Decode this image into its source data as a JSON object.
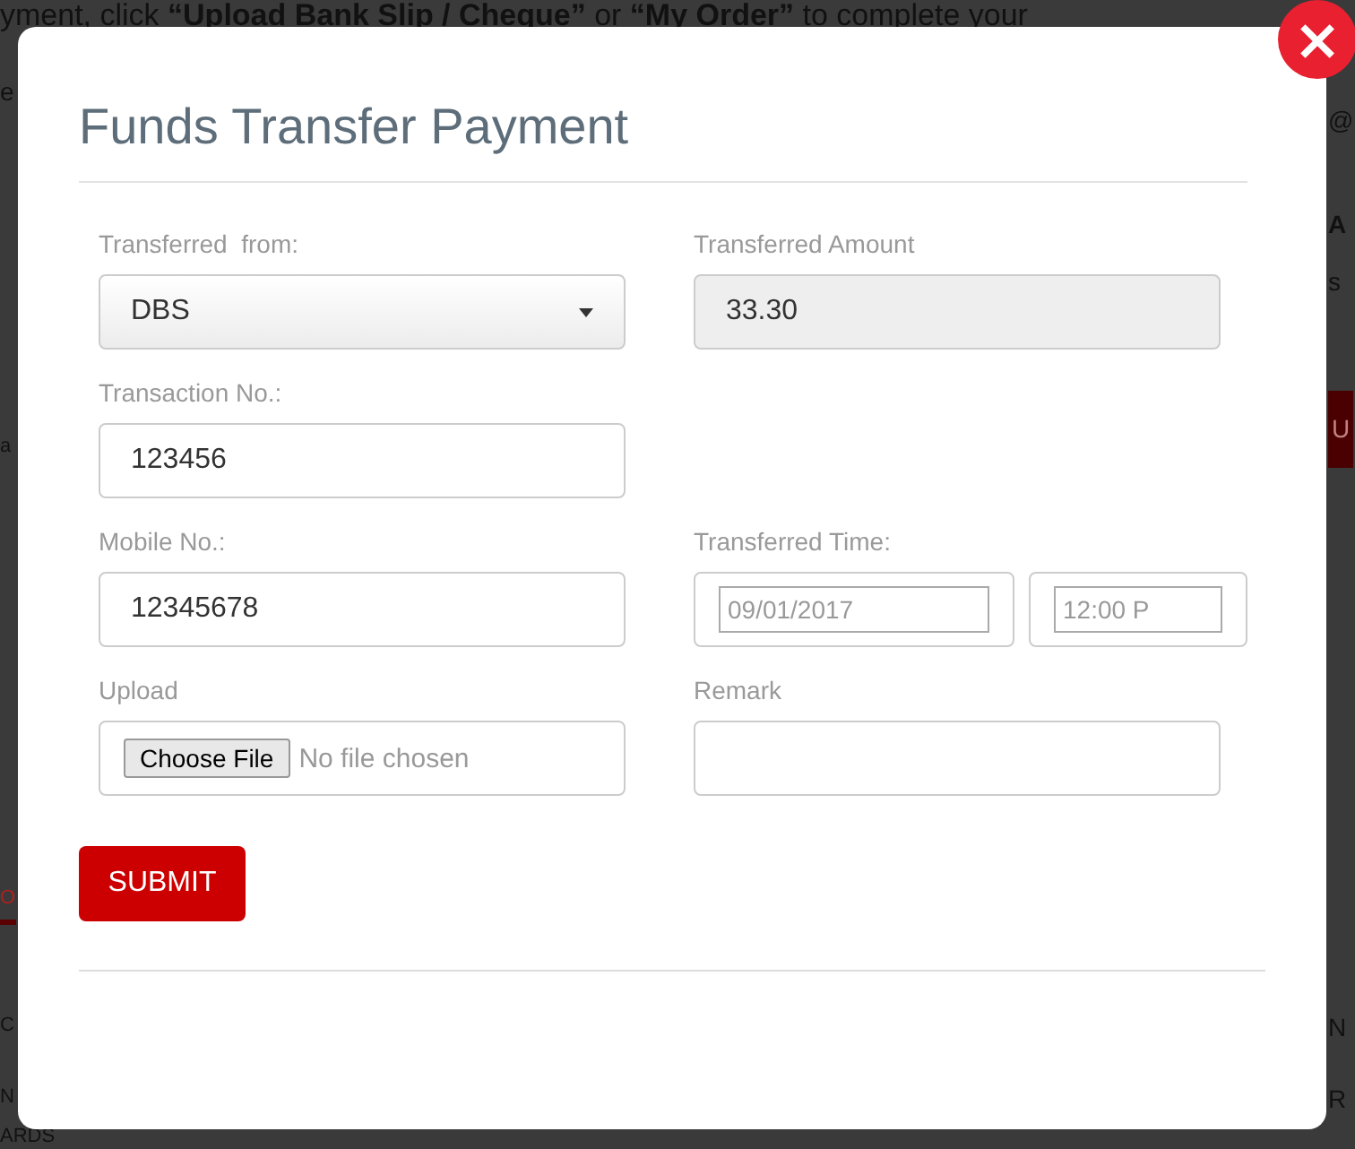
{
  "background_page": {
    "intro_text": "yment, click **“Upload Bank Slip / Cheque”** or **“My Order”** to complete your",
    "intro_text_line_2": "e",
    "left_fragments": [
      {
        "text": "a",
        "kind": "plain"
      },
      {
        "text": "O",
        "kind": "tab"
      },
      {
        "text": "C",
        "kind": "plain"
      },
      {
        "text": "N",
        "kind": "plain"
      },
      {
        "text": "ARDS",
        "kind": "plain"
      }
    ],
    "right_fragments": [
      {
        "text": "@",
        "kind": "plain"
      },
      {
        "text": "A",
        "kind": "bold"
      },
      {
        "text": "s",
        "kind": "plain"
      },
      {
        "text": "U",
        "kind": "button"
      },
      {
        "text": "N",
        "kind": "plain"
      },
      {
        "text": "R",
        "kind": "plain"
      }
    ]
  },
  "modal": {
    "title": "Funds Transfer Payment",
    "close": "×",
    "rows": [
      [
        {
          "label": "Transferred  from:",
          "kind": "select",
          "value": "DBS"
        },
        {
          "label": "Transferred Amount",
          "kind": "readonly",
          "value": "33.30"
        }
      ],
      [
        {
          "label": "Transaction No.:",
          "kind": "text",
          "value": "123456"
        }
      ],
      [
        {
          "label": "Mobile No.:",
          "kind": "text",
          "value": "12345678"
        },
        {
          "label": "Transferred Time:",
          "kind": "datetime",
          "date": "09/01/2017",
          "time": "12:00 P"
        }
      ],
      [
        {
          "label": "Upload",
          "kind": "file",
          "button": "Choose File",
          "status": "No file chosen"
        },
        {
          "label": "Remark",
          "kind": "text"
        }
      ]
    ],
    "submit": "SUBMIT"
  }
}
